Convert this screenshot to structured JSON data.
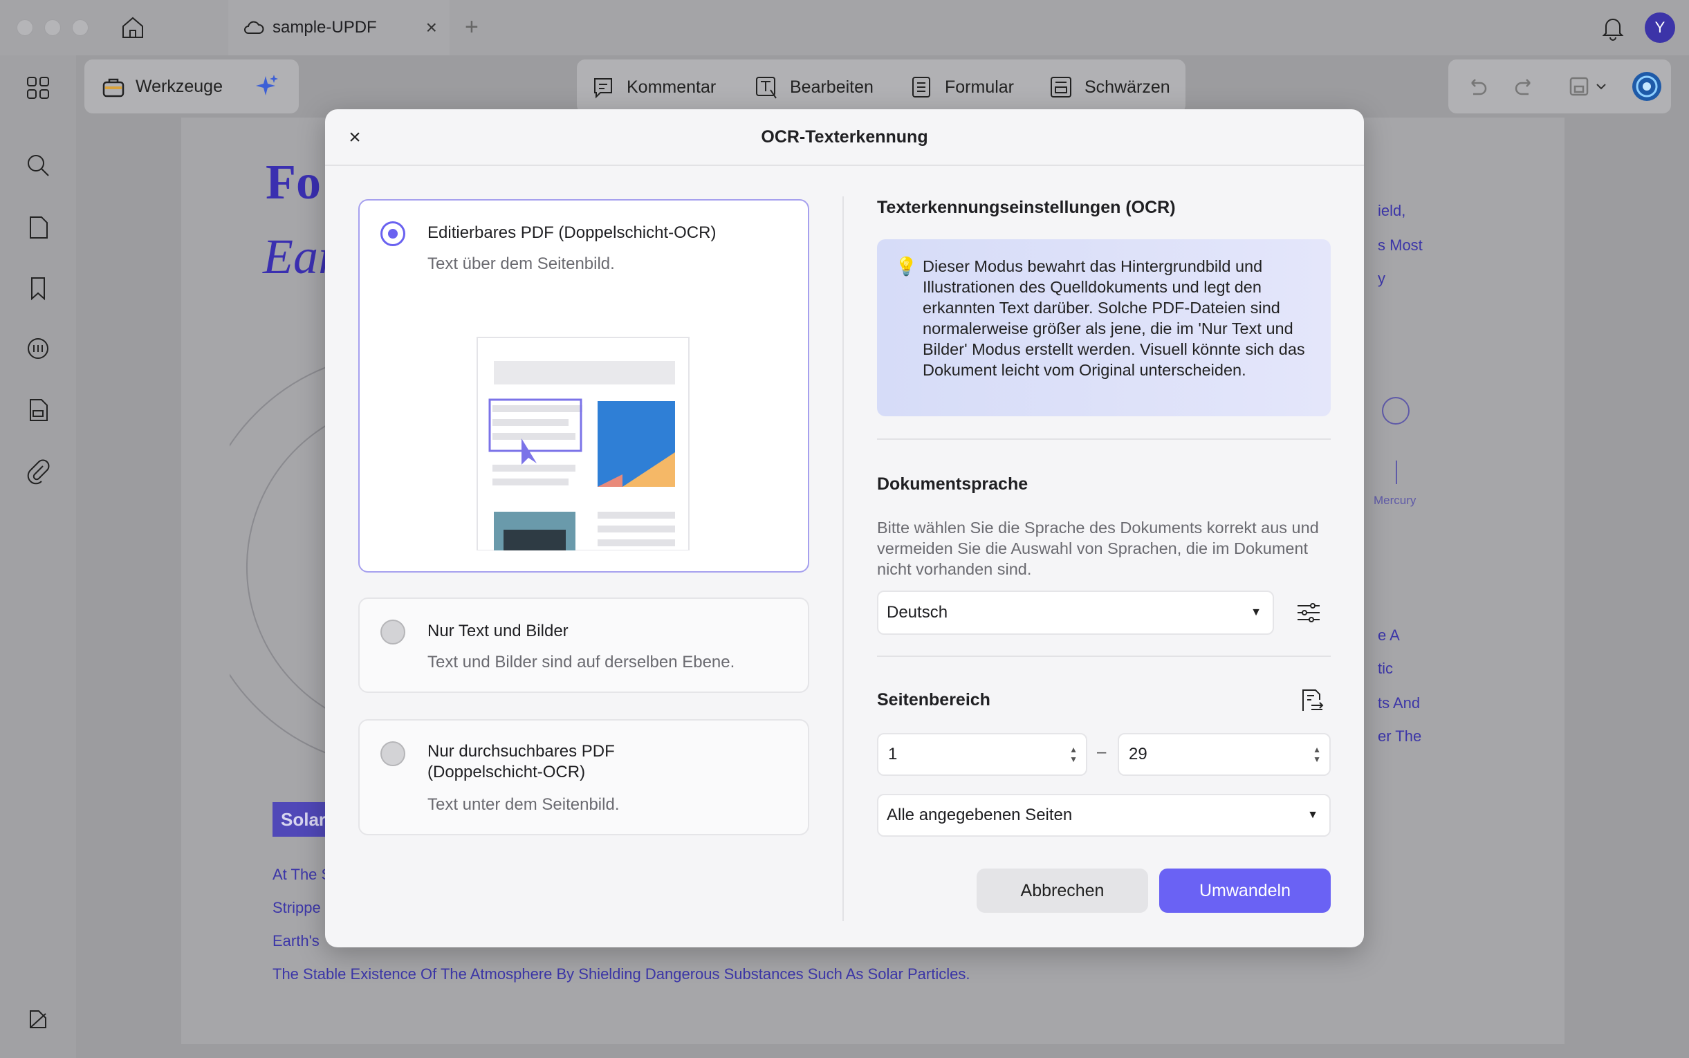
{
  "window": {
    "tab_title": "sample-UPDF",
    "tab_close": "×",
    "new_tab": "+",
    "avatar_letter": "Y"
  },
  "toolbar": {
    "tools_label": "Werkzeuge",
    "modes": [
      "Kommentar",
      "Bearbeiten",
      "Formular",
      "Schwärzen"
    ]
  },
  "document_bg": {
    "title_fragment_1": "Fo",
    "title_fragment_2": "Ear",
    "right_fragments": [
      "ield,",
      "s Most",
      "y",
      "e A",
      "tic",
      "ts And",
      "er The"
    ],
    "planet_label": "Mercury",
    "badge_fragment": "Solar",
    "body_fragments": [
      "At The S",
      "Strippe",
      "Earth's"
    ],
    "body_last_line": "The Stable Existence Of The Atmosphere By Shielding Dangerous Substances Such As Solar Particles."
  },
  "dialog": {
    "title": "OCR-Texterkennung",
    "close": "×",
    "options": [
      {
        "title": "Editierbares PDF (Doppelschicht-OCR)",
        "subtitle": "Text über dem Seitenbild.",
        "selected": true
      },
      {
        "title": "Nur Text und Bilder",
        "subtitle": "Text und Bilder sind auf derselben Ebene.",
        "selected": false
      },
      {
        "title": "Nur durchsuchbares PDF (Doppelschicht-OCR)",
        "subtitle": "Text unter dem Seitenbild.",
        "selected": false
      }
    ],
    "settings_title": "Texterkennungseinstellungen (OCR)",
    "info_text": "Dieser Modus bewahrt das Hintergrundbild und Illustrationen des Quelldokuments und legt den erkannten Text darüber. Solche PDF-Dateien sind normalerweise größer als jene, die im 'Nur Text und Bilder' Modus erstellt werden. Visuell könnte sich das Dokument leicht vom Original unterscheiden.",
    "language_title": "Dokumentsprache",
    "language_desc": "Bitte wählen Sie die Sprache des Dokuments korrekt aus und vermeiden Sie die Auswahl von Sprachen, die im Dokument nicht vorhanden sind.",
    "language_value": "Deutsch",
    "range_title": "Seitenbereich",
    "range_from": "1",
    "range_to": "29",
    "range_sep": "–",
    "range_mode": "Alle angegebenen Seiten",
    "cancel": "Abbrechen",
    "confirm": "Umwandeln"
  },
  "colors": {
    "accent": "#6a62f4",
    "info_bg": "#d6dcf8",
    "doc_text": "#3c36a8"
  }
}
